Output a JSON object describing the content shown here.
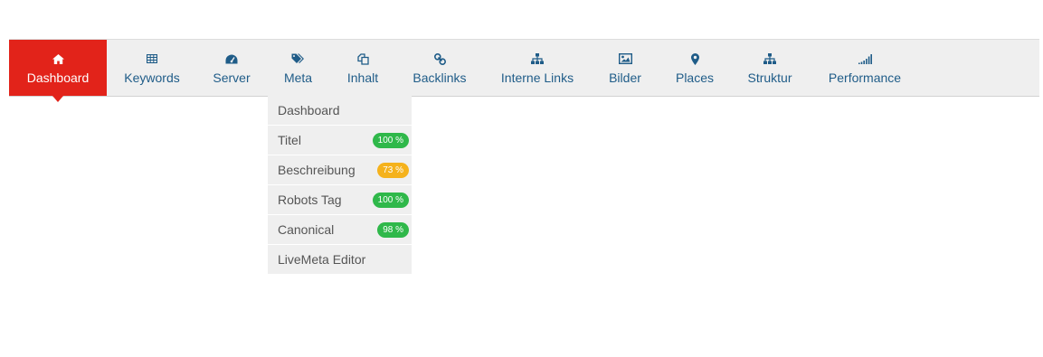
{
  "colors": {
    "accent": "#e2231a",
    "link": "#1f5c88",
    "badge_green": "#2fb84a",
    "badge_yellow": "#f5b21c"
  },
  "nav": {
    "items": [
      {
        "label": "Dashboard",
        "icon": "home-icon",
        "active": true
      },
      {
        "label": "Keywords",
        "icon": "table-icon"
      },
      {
        "label": "Server",
        "icon": "gauge-icon"
      },
      {
        "label": "Meta",
        "icon": "tags-icon"
      },
      {
        "label": "Inhalt",
        "icon": "copy-icon"
      },
      {
        "label": "Backlinks",
        "icon": "link-icon"
      },
      {
        "label": "Interne Links",
        "icon": "sitemap-icon"
      },
      {
        "label": "Bilder",
        "icon": "image-icon"
      },
      {
        "label": "Places",
        "icon": "map-marker-icon"
      },
      {
        "label": "Struktur",
        "icon": "sitemap-icon"
      },
      {
        "label": "Performance",
        "icon": "signal-icon"
      }
    ]
  },
  "meta_dropdown": {
    "items": [
      {
        "label": "Dashboard"
      },
      {
        "label": "Titel",
        "badge": "100 %",
        "badge_color": "#2fb84a"
      },
      {
        "label": "Beschreibung",
        "badge": "73 %",
        "badge_color": "#f5b21c"
      },
      {
        "label": "Robots Tag",
        "badge": "100 %",
        "badge_color": "#2fb84a"
      },
      {
        "label": "Canonical",
        "badge": "98 %",
        "badge_color": "#2fb84a"
      },
      {
        "label": "LiveMeta Editor"
      }
    ]
  }
}
